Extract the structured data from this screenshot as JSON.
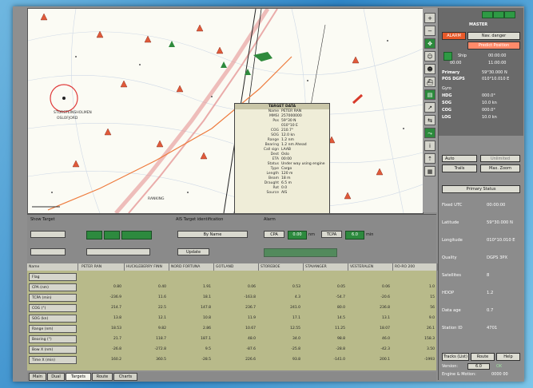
{
  "right_panel": {
    "master_label": "MASTER",
    "btn_red": "ALARM",
    "btn_nav": "Nav. danger",
    "btn_predict": "Predict Position",
    "ship_label": "Ship",
    "ship_time": "00:00:00",
    "ship_time2": "11:00:00",
    "mode_label": "00:00",
    "primary_label": "Primary",
    "primary_val": "59°30.000 N",
    "pos_label": "POS DGPS",
    "pos_val": "010°10.010 E",
    "gyro_label": "Gyro",
    "hdg_label": "HDG",
    "hdg_val": "000.0°",
    "sog_label": "SOG",
    "sog_val": "10.0 kn",
    "cog_label": "COG",
    "cog_val": "000.0°",
    "log_label": "LOG",
    "log_val": "10.0 kn",
    "sel1": "Auto",
    "sel2": "Unlimited",
    "btn_trails": "Trails",
    "btn_maxzoom": "Max. Zoom",
    "primary_status": "Primary Status",
    "stats": [
      {
        "k": "Fixed UTC",
        "v": "00:00:00"
      },
      {
        "k": "Latitude",
        "v": "59°30.000 N"
      },
      {
        "k": "Longitude",
        "v": "010°10.010 E"
      },
      {
        "k": "Quality",
        "v": "DGPS 3PX"
      },
      {
        "k": "Satellites",
        "v": "8"
      },
      {
        "k": "HDOP",
        "v": "1.2"
      },
      {
        "k": "Data age",
        "v": "0.7"
      },
      {
        "k": "Station ID",
        "v": "4701"
      }
    ],
    "btn_tracks": "Tracks (List)",
    "btn_route": "Route",
    "btn_help": "Help",
    "version_label": "Version:",
    "version_val": "6.0",
    "version_state": "OK",
    "engine_label": "Engine & Motion:",
    "engine_val": "0000 00"
  },
  "control": {
    "show_target": "Show Target",
    "ais_title": "AIS Target identification",
    "by_name": "By Name",
    "update": "Update",
    "alarm_title": "Alarm",
    "alarm_val1": "CPA",
    "alarm_val2": "0.00",
    "alarm_unit": "nm",
    "alarm_val3": "TCPA",
    "alarm_val4": "6.0",
    "alarm_unit2": "min"
  },
  "popup": {
    "title": "TARGET DATA",
    "rows": [
      {
        "k": "Name",
        "v": "PETER RAN"
      },
      {
        "k": "MMSI",
        "v": "257000000"
      },
      {
        "k": "Pos",
        "v": "59°30 N"
      },
      {
        "k": "",
        "v": "010°10 E"
      },
      {
        "k": "COG",
        "v": "210.7°"
      },
      {
        "k": "SOG",
        "v": "12.0 kn"
      },
      {
        "k": "Range",
        "v": "1.2 nm"
      },
      {
        "k": "Bearing",
        "v": "1.2 nm Ahead"
      },
      {
        "k": "",
        "v": ""
      },
      {
        "k": "Call sign",
        "v": "LAAB"
      },
      {
        "k": "Dest",
        "v": "Oslo"
      },
      {
        "k": "ETA",
        "v": "00:00"
      },
      {
        "k": "Status",
        "v": "Under way using engine"
      },
      {
        "k": "Type",
        "v": "Cargo"
      },
      {
        "k": "",
        "v": ""
      },
      {
        "k": "Length",
        "v": "120 m"
      },
      {
        "k": "Beam",
        "v": "18 m"
      },
      {
        "k": "Draught",
        "v": "6.5 m"
      },
      {
        "k": "Rot",
        "v": "0.0"
      },
      {
        "k": "Source",
        "v": "AIS"
      }
    ]
  },
  "table": {
    "header_first": "Name",
    "columns": [
      "PETER RAN",
      "HUCKLEBERRY FINN",
      "NORD FORTUNA",
      "GOTLAND",
      "STOREBOE",
      "STAVANGER",
      "VESTERALEN",
      "RO-RO 200"
    ],
    "row_labels": [
      "Flag",
      "CPA (nm)",
      "TCPA (min)",
      "COG (°)",
      "SOG (kn)",
      "Range (nm)",
      "Bearing (°)",
      "Bow X (nm)",
      "Time X (min)"
    ],
    "rows": [
      [
        "",
        "",
        "",
        "",
        "",
        "",
        "",
        ""
      ],
      [
        "0.80",
        "0.40",
        "1.91",
        "0.06",
        "0.53",
        "0.05",
        "0.06",
        "1.0"
      ],
      [
        "-236.9",
        "11.6",
        "18.1",
        "-163.8",
        "4.3",
        "-54.7",
        "-20.6",
        "15"
      ],
      [
        "214.7",
        "22.5",
        "147.8",
        "236.7",
        "241.0",
        "80.0",
        "236.8",
        "56"
      ],
      [
        "13.8",
        "12.1",
        "10.8",
        "11.9",
        "17.1",
        "14.5",
        "13.1",
        "9.0"
      ],
      [
        "18.53",
        "9.82",
        "2.86",
        "10.67",
        "12.55",
        "11.25",
        "18.07",
        "26.1"
      ],
      [
        "21.7",
        "118.7",
        "187.1",
        "48.0",
        "34.0",
        "98.8",
        "46.0",
        "158.3"
      ],
      [
        "-26.8",
        "-272.8",
        "9.5",
        "-87.6",
        "-25.8",
        "-28.8",
        "-42.3",
        "3.50"
      ],
      [
        "160.2",
        "360.5",
        "-28.5",
        "226.6",
        "93.8",
        "-141.0",
        "200.1",
        "-1993"
      ]
    ]
  },
  "tabs": [
    "Main",
    "Dual",
    "Targets",
    "Route",
    "Charts"
  ],
  "chart": {
    "labels": [
      "STORSTEINSHOLMEN",
      "OSLOFJORD",
      "SKAGEN",
      "RANKING"
    ]
  }
}
